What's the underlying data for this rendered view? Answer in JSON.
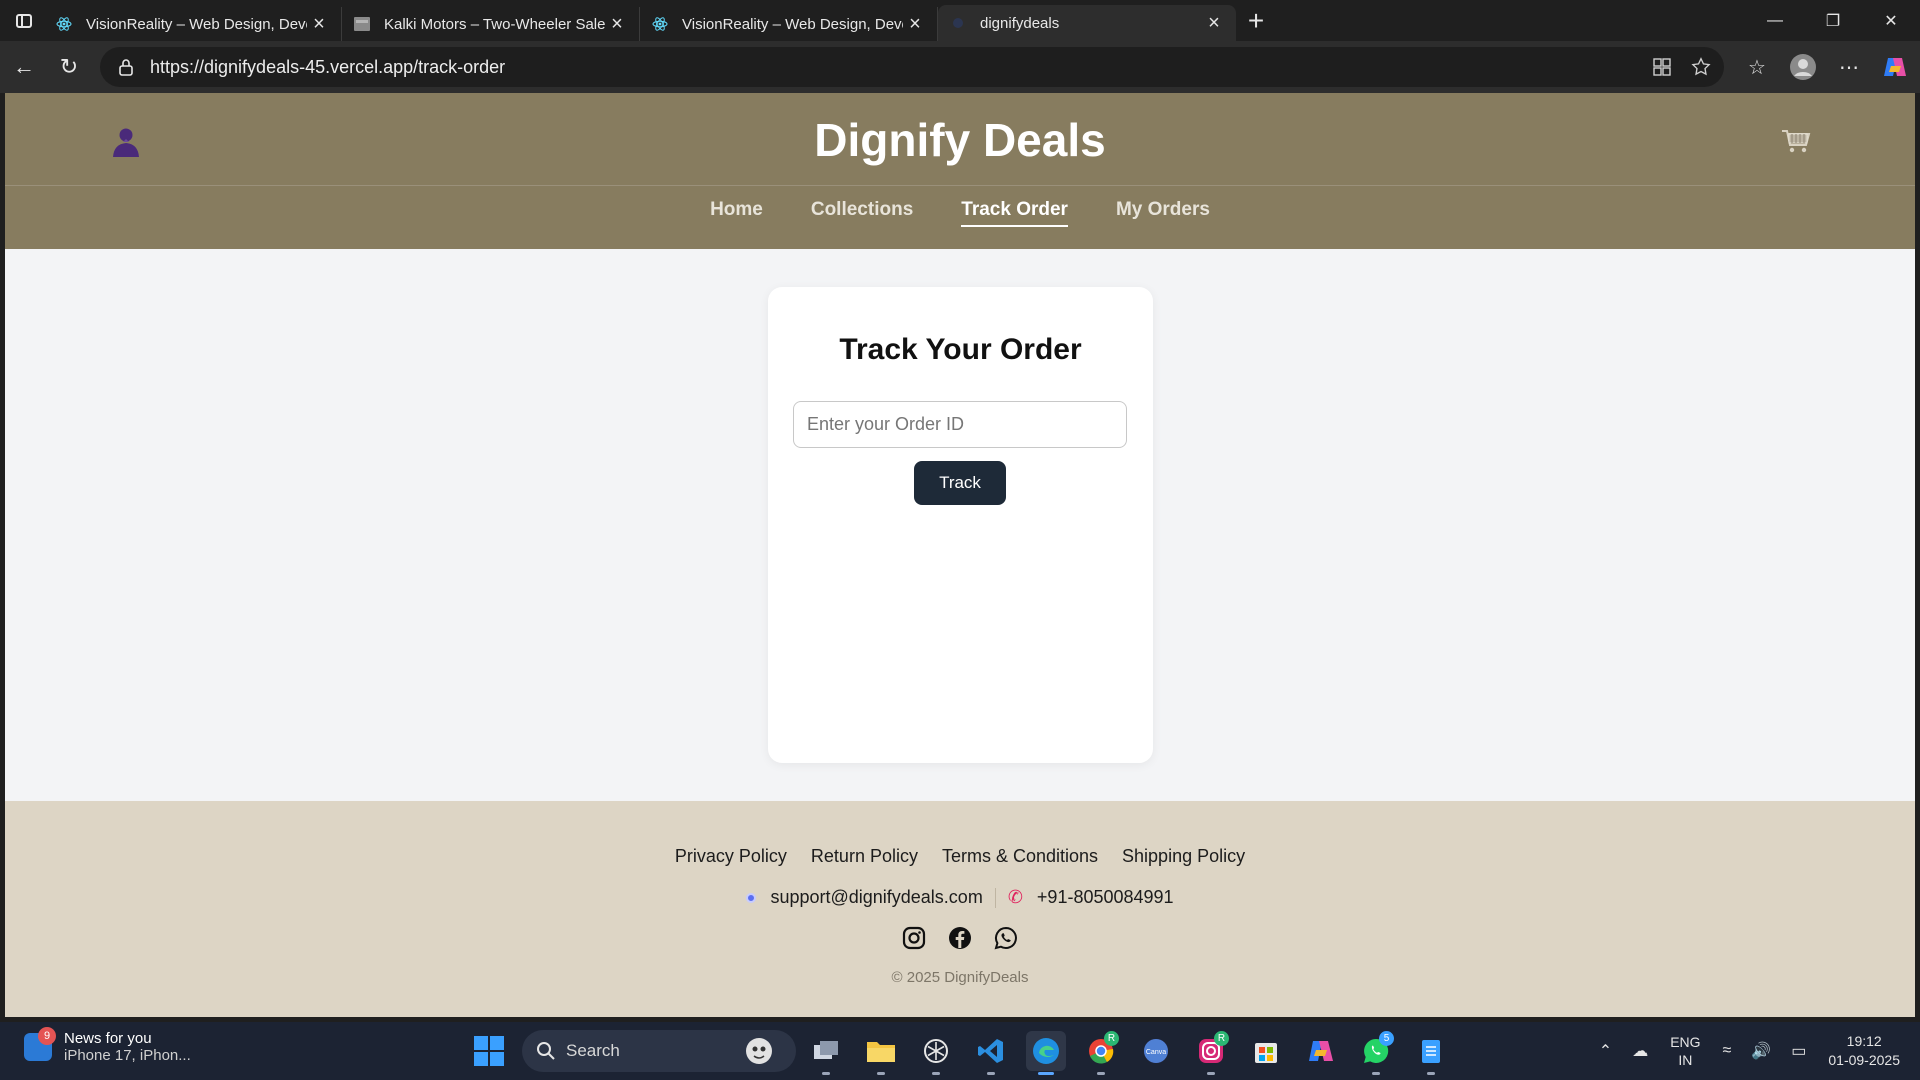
{
  "browser": {
    "tabs": [
      {
        "title": "VisionReality – Web Design, Deve",
        "icon": "react-icon"
      },
      {
        "title": "Kalki Motors – Two-Wheeler Sale",
        "icon": "image-icon"
      },
      {
        "title": "VisionReality – Web Design, Deve",
        "icon": "react-icon"
      },
      {
        "title": "dignifydeals",
        "icon": "react-icon"
      }
    ],
    "active_tab": 3,
    "url": "https://dignifydeals-45.vercel.app/track-order"
  },
  "site": {
    "brand": "Dignify Deals",
    "nav": [
      {
        "label": "Home",
        "active": false
      },
      {
        "label": "Collections",
        "active": false
      },
      {
        "label": "Track Order",
        "active": true
      },
      {
        "label": "My Orders",
        "active": false
      }
    ],
    "colors": {
      "header_bg": "#877c5f",
      "footer_bg": "#ddd5c5",
      "button_bg": "#1e2a38",
      "user_icon": "#4a2a7a"
    }
  },
  "track": {
    "heading": "Track Your Order",
    "input_placeholder": "Enter your Order ID",
    "input_value": "",
    "button_label": "Track"
  },
  "footer": {
    "policies": [
      "Privacy Policy",
      "Return Policy",
      "Terms & Conditions",
      "Shipping Policy"
    ],
    "email": "support@dignifydeals.com",
    "phone": "+91-8050084991",
    "social": [
      "instagram-icon",
      "facebook-icon",
      "whatsapp-icon"
    ],
    "copyright": "© 2025 DignifyDeals"
  },
  "taskbar": {
    "news_title": "News for you",
    "news_sub": "iPhone 17, iPhon...",
    "news_badge": "9",
    "search_label": "Search",
    "whatsapp_badge": "5",
    "lang_line1": "ENG",
    "lang_line2": "IN",
    "time": "19:12",
    "date": "01-09-2025"
  }
}
